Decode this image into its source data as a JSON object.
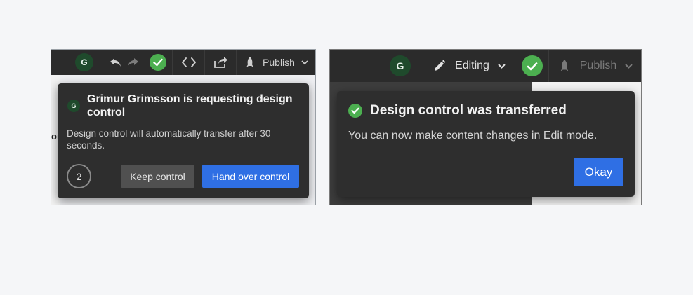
{
  "left_panel": {
    "toolbar": {
      "avatar_initial": "G",
      "publish_label": "Publish"
    },
    "edge_text": "oı",
    "dialog": {
      "avatar_initial": "G",
      "title": "Grimur Grimsson is requesting design control",
      "body": "Design control will automatically transfer after 30 seconds.",
      "countdown": "2",
      "keep_label": "Keep control",
      "handover_label": "Hand over control"
    }
  },
  "right_panel": {
    "toolbar": {
      "avatar_initial": "G",
      "mode_label": "Editing",
      "publish_label": "Publish"
    },
    "dialog": {
      "title": "Design control was transferred",
      "body": "You can now make content changes in Edit mode.",
      "okay_label": "Okay"
    }
  },
  "colors": {
    "accent_blue": "#2f6fe4",
    "success_green": "#4caf50",
    "dialog_bg": "#2e2e2e",
    "toolbar_bg": "#2b2b2b"
  }
}
